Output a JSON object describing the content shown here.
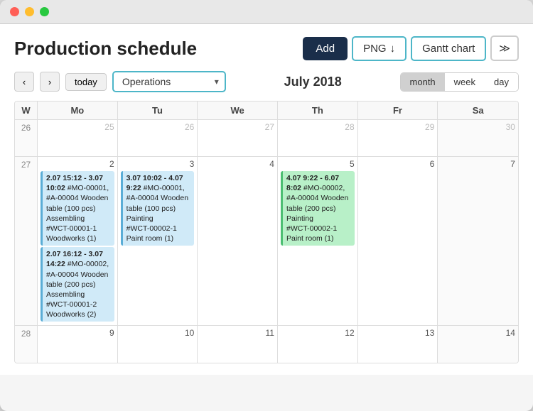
{
  "window": {
    "title": "Production schedule"
  },
  "header": {
    "title": "Production schedule",
    "add_label": "Add",
    "png_label": "PNG",
    "gantt_label": "Gantt chart",
    "more_icon": "⋮"
  },
  "toolbar": {
    "prev_icon": "‹",
    "next_icon": "›",
    "today_label": "today",
    "operations_label": "Operations",
    "month_title": "July 2018",
    "view_month": "month",
    "view_week": "week",
    "view_day": "day"
  },
  "calendar": {
    "headers": [
      "W",
      "Mo",
      "Tu",
      "We",
      "Th",
      "Fr",
      "Sa"
    ],
    "rows": [
      {
        "week": "26",
        "days": [
          {
            "num": "25",
            "other": true
          },
          {
            "num": "26",
            "other": true
          },
          {
            "num": "27",
            "other": true
          },
          {
            "num": "28",
            "other": true
          },
          {
            "num": "29",
            "other": true
          },
          {
            "num": "30",
            "other": true
          }
        ]
      },
      {
        "week": "27",
        "days": [
          {
            "num": "2"
          },
          {
            "num": "3"
          },
          {
            "num": "4"
          },
          {
            "num": "5"
          },
          {
            "num": "6"
          },
          {
            "num": "7"
          }
        ]
      },
      {
        "week": "28",
        "days": [
          {
            "num": "9"
          },
          {
            "num": "10"
          },
          {
            "num": "11"
          },
          {
            "num": "12"
          },
          {
            "num": "13"
          },
          {
            "num": "14"
          }
        ]
      }
    ],
    "events": {
      "row1_mo": [
        {
          "type": "blue",
          "text": "2.07 15:12 - 3.07 10:02 #MO-00001, #A-00004 Wooden table (100 pcs) Assembling #WCT-00001-1 Woodworks (1)"
        },
        {
          "type": "blue",
          "text": "2.07 16:12 - 3.07 14:22 #MO-00002, #A-00004 Wooden table (200 pcs) Assembling #WCT-00001-2 Woodworks (2)"
        }
      ],
      "row1_tu": [
        {
          "type": "blue",
          "text": "3.07 10:02 - 4.07 9:22 #MO-00001, #A-00004 Wooden table (100 pcs) Painting #WCT-00002-1 Paint room (1)"
        }
      ],
      "row1_th": [
        {
          "type": "green",
          "text": "4.07 9:22 - 6.07 8:02 #MO-00002, #A-00004 Wooden table (200 pcs) Painting #WCT-00002-1 Paint room (1)"
        }
      ]
    }
  }
}
